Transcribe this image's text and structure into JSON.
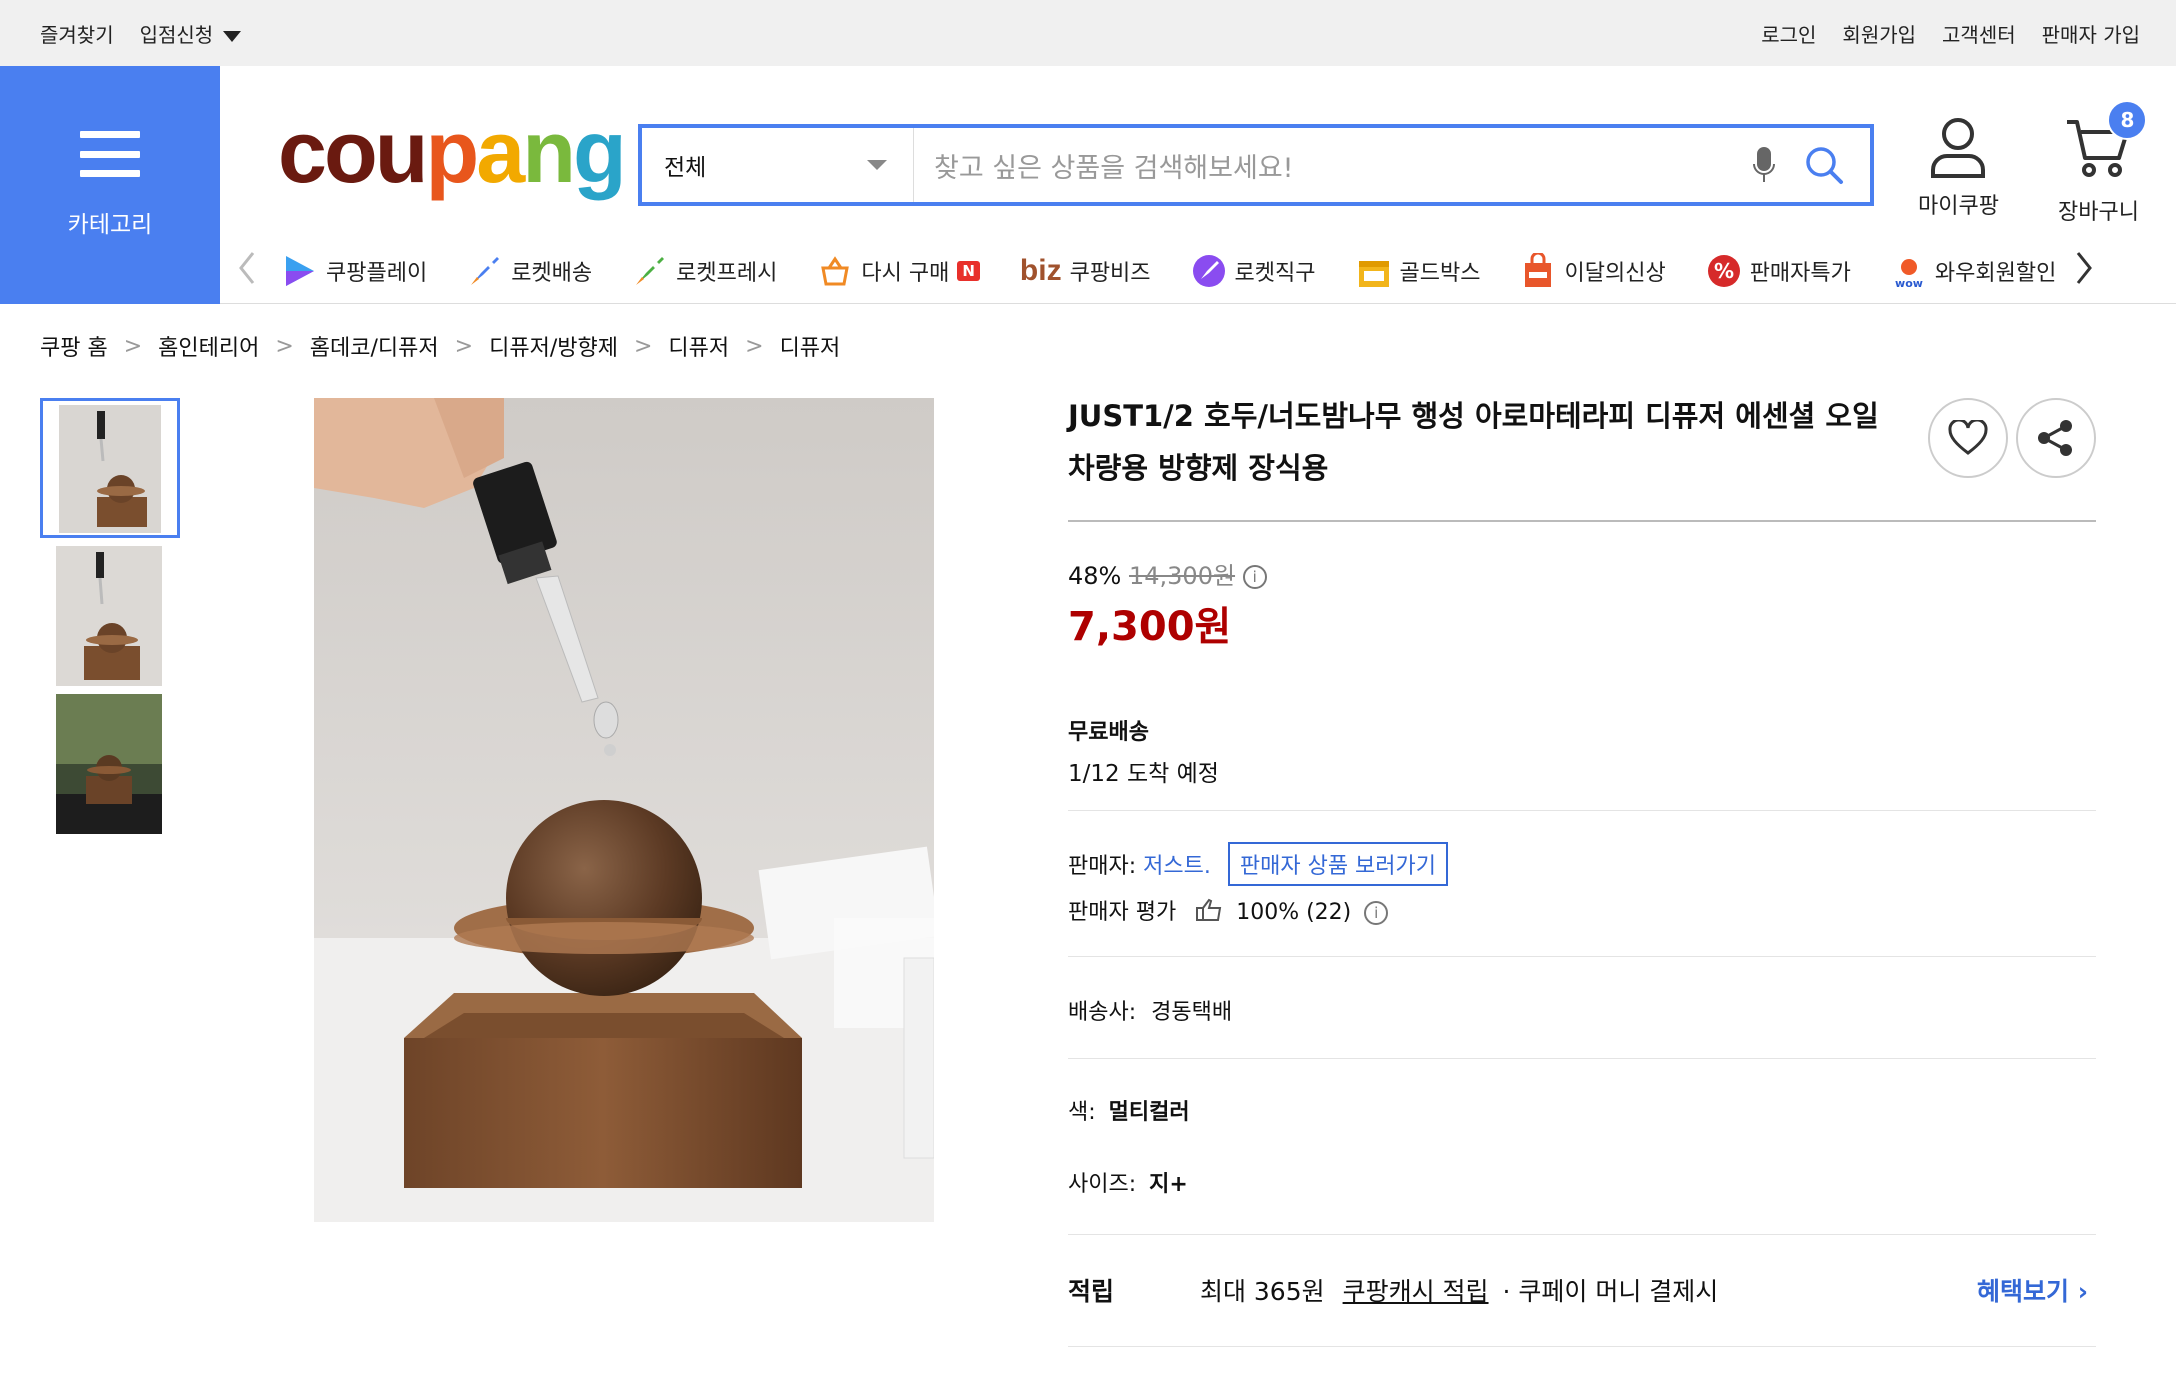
{
  "topbar": {
    "left": [
      "즐겨찾기",
      "입점신청"
    ],
    "right": [
      "로그인",
      "회원가입",
      "고객센터",
      "판매자 가입"
    ]
  },
  "category": {
    "label": "카테고리"
  },
  "logo": {
    "text": "coupang"
  },
  "search": {
    "category": "전체",
    "placeholder": "찾고 싶은 상품을 검색해보세요!"
  },
  "header": {
    "mycoupang": "마이쿠팡",
    "cart": "장바구니",
    "cart_count": "8"
  },
  "nav": {
    "items": [
      "쿠팡플레이",
      "로켓배송",
      "로켓프레시",
      "다시 구매",
      "쿠팡비즈",
      "로켓직구",
      "골드박스",
      "이달의신상",
      "판매자특가",
      "와우회원할인"
    ],
    "biz_prefix": "biz",
    "repurchase_badge": "N"
  },
  "breadcrumb": [
    "쿠팡 홈",
    "홈인테리어",
    "홈데코/디퓨저",
    "디퓨저/방향제",
    "디퓨저",
    "디퓨저"
  ],
  "product": {
    "title": "JUST1/2 호두/너도밤나무 행성 아로마테라피 디퓨저 에센셜 오일 차량용 방향제 장식용",
    "discount": "48%",
    "original_price": "14,300원",
    "price": "7,300원",
    "shipping_label": "무료배송",
    "arrival": "1/12 도착 예정",
    "seller_label": "판매자:",
    "seller_name": "저스트.",
    "seller_button": "판매자 상품 보러가기",
    "rating_label": "판매자 평가",
    "rating_value": "100% (22)",
    "carrier_label": "배송사:",
    "carrier": "경동택배",
    "color_label": "색:",
    "color": "멀티컬러",
    "size_label": "사이즈:",
    "size": "지+",
    "reward_label": "적립",
    "reward_text": "최대 365원",
    "reward_link": "쿠팡캐시 적립",
    "reward_suffix": "· 쿠페이 머니 결제시",
    "benefit_link": "혜택보기"
  }
}
